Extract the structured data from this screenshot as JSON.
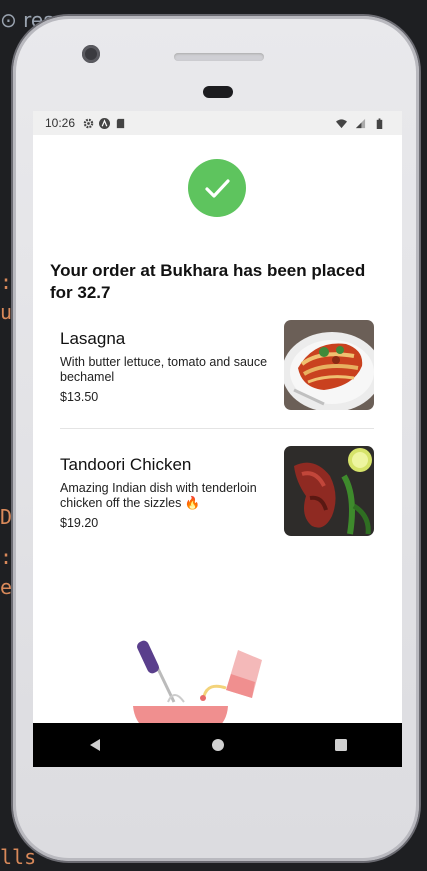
{
  "status_bar": {
    "time": "10:26",
    "icons": [
      "settings-icon",
      "a-icon",
      "sd-card-icon",
      "wifi-icon",
      "signal-icon",
      "battery-icon"
    ]
  },
  "order": {
    "headline": "Your order at Bukhara has been placed for 32.7",
    "items": [
      {
        "name": "Lasagna",
        "description": "With butter lettuce, tomato and sauce bechamel",
        "price": "$13.50"
      },
      {
        "name": "Tandoori Chicken",
        "description": "Amazing Indian dish with tenderloin chicken off the sizzles 🔥",
        "price": "$19.20"
      }
    ]
  },
  "colors": {
    "success": "#5ec45e",
    "bowl": "#f08f8f",
    "navbar": "#000000"
  },
  "nav": {
    "buttons": [
      "back-icon",
      "home-icon",
      "recents-icon"
    ]
  }
}
